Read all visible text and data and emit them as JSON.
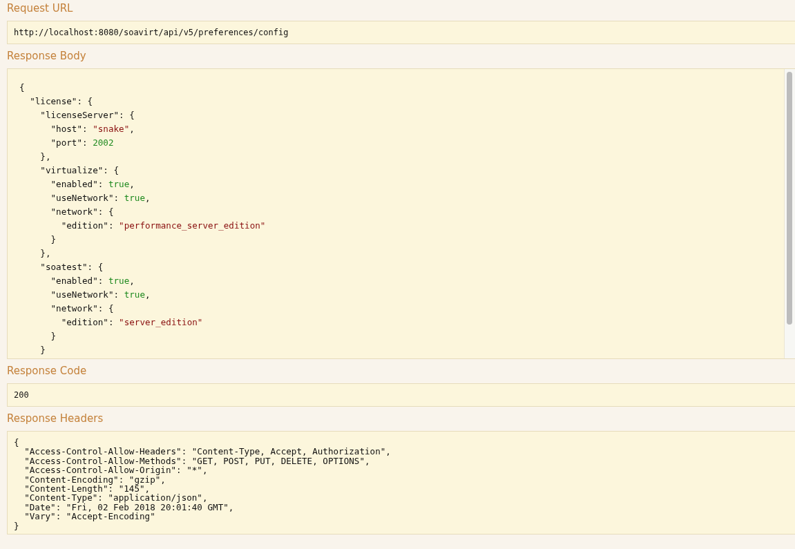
{
  "sections": [
    {
      "kind": "plain",
      "label": "Request URL",
      "value": "http://localhost:8080/soavirt/api/v5/preferences/config"
    },
    {
      "kind": "code",
      "label": "Response Body",
      "lines": [
        [
          {
            "kind": "punct",
            "text": "{"
          }
        ],
        [
          {
            "kind": "key",
            "text": "  \"license\""
          },
          {
            "kind": "punct",
            "text": ": {"
          }
        ],
        [
          {
            "kind": "key",
            "text": "    \"licenseServer\""
          },
          {
            "kind": "punct",
            "text": ": {"
          }
        ],
        [
          {
            "kind": "key",
            "text": "      \"host\""
          },
          {
            "kind": "punct",
            "text": ": "
          },
          {
            "kind": "string",
            "text": "\"snake\""
          },
          {
            "kind": "punct",
            "text": ","
          }
        ],
        [
          {
            "kind": "key",
            "text": "      \"port\""
          },
          {
            "kind": "punct",
            "text": ": "
          },
          {
            "kind": "number",
            "text": "2002"
          }
        ],
        [
          {
            "kind": "punct",
            "text": "    },"
          }
        ],
        [
          {
            "kind": "key",
            "text": "    \"virtualize\""
          },
          {
            "kind": "punct",
            "text": ": {"
          }
        ],
        [
          {
            "kind": "key",
            "text": "      \"enabled\""
          },
          {
            "kind": "punct",
            "text": ": "
          },
          {
            "kind": "number",
            "text": "true"
          },
          {
            "kind": "punct",
            "text": ","
          }
        ],
        [
          {
            "kind": "key",
            "text": "      \"useNetwork\""
          },
          {
            "kind": "punct",
            "text": ": "
          },
          {
            "kind": "number",
            "text": "true"
          },
          {
            "kind": "punct",
            "text": ","
          }
        ],
        [
          {
            "kind": "key",
            "text": "      \"network\""
          },
          {
            "kind": "punct",
            "text": ": {"
          }
        ],
        [
          {
            "kind": "key",
            "text": "        \"edition\""
          },
          {
            "kind": "punct",
            "text": ": "
          },
          {
            "kind": "string",
            "text": "\"performance_server_edition\""
          }
        ],
        [
          {
            "kind": "punct",
            "text": "      }"
          }
        ],
        [
          {
            "kind": "punct",
            "text": "    },"
          }
        ],
        [
          {
            "kind": "key",
            "text": "    \"soatest\""
          },
          {
            "kind": "punct",
            "text": ": {"
          }
        ],
        [
          {
            "kind": "key",
            "text": "      \"enabled\""
          },
          {
            "kind": "punct",
            "text": ": "
          },
          {
            "kind": "number",
            "text": "true"
          },
          {
            "kind": "punct",
            "text": ","
          }
        ],
        [
          {
            "kind": "key",
            "text": "      \"useNetwork\""
          },
          {
            "kind": "punct",
            "text": ": "
          },
          {
            "kind": "number",
            "text": "true"
          },
          {
            "kind": "punct",
            "text": ","
          }
        ],
        [
          {
            "kind": "key",
            "text": "      \"network\""
          },
          {
            "kind": "punct",
            "text": ": {"
          }
        ],
        [
          {
            "kind": "key",
            "text": "        \"edition\""
          },
          {
            "kind": "punct",
            "text": ": "
          },
          {
            "kind": "string",
            "text": "\"server_edition\""
          }
        ],
        [
          {
            "kind": "punct",
            "text": "      }"
          }
        ],
        [
          {
            "kind": "punct",
            "text": "    }"
          }
        ]
      ]
    },
    {
      "kind": "plain",
      "label": "Response Code",
      "value": "200"
    },
    {
      "kind": "block",
      "label": "Response Headers",
      "lines": [
        "{",
        "  \"Access-Control-Allow-Headers\": \"Content-Type, Accept, Authorization\",",
        "  \"Access-Control-Allow-Methods\": \"GET, POST, PUT, DELETE, OPTIONS\",",
        "  \"Access-Control-Allow-Origin\": \"*\",",
        "  \"Content-Encoding\": \"gzip\",",
        "  \"Content-Length\": \"145\",",
        "  \"Content-Type\": \"application/json\",",
        "  \"Date\": \"Fri, 02 Feb 2018 20:01:40 GMT\",",
        "  \"Vary\": \"Accept-Encoding\"",
        "}"
      ]
    }
  ]
}
